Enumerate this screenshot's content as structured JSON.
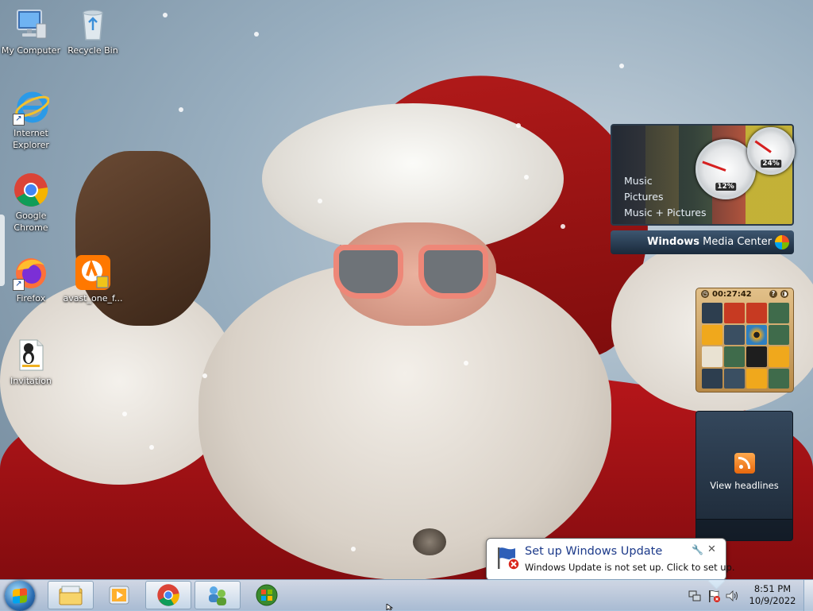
{
  "desktop": {
    "icons": [
      {
        "label": "My Computer",
        "icon": "computer-icon"
      },
      {
        "label": "Recycle Bin",
        "icon": "recycle-bin-icon"
      },
      {
        "label": "Internet Explorer",
        "icon": "internet-explorer-icon"
      },
      {
        "label": "Google Chrome",
        "icon": "chrome-icon"
      },
      {
        "label": "Firefox",
        "icon": "firefox-icon"
      },
      {
        "label": "avast_one_f...",
        "icon": "avast-installer-icon"
      },
      {
        "label": "Invitation",
        "icon": "text-document-icon"
      }
    ]
  },
  "gadgets": {
    "media_center": {
      "menu": [
        "Music",
        "Pictures",
        "Music + Pictures"
      ],
      "title_bold": "Windows",
      "title_rest": " Media Center",
      "cpu_meter": {
        "cpu": "12%",
        "memory": "24%"
      }
    },
    "puzzle": {
      "timer": "00:27:42",
      "help": "?",
      "toggle": "◑"
    },
    "feed": {
      "text": "View headlines"
    }
  },
  "notification": {
    "title": "Set up Windows Update",
    "text": "Windows Update is not set up. Click to set up.",
    "options_icon": "wrench-icon",
    "close": "✕"
  },
  "taskbar": {
    "pinned": [
      "file-explorer-icon",
      "media-player-icon",
      "chrome-icon",
      "network-users-icon",
      "windows-media-center-icon"
    ],
    "clock": {
      "time": "8:51 PM",
      "date": "10/9/2022"
    }
  }
}
